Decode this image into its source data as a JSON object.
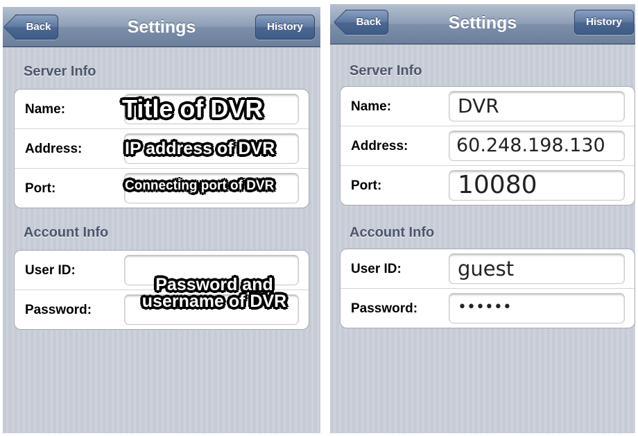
{
  "left": {
    "nav": {
      "back": "Back",
      "title": "Settings",
      "history": "History"
    },
    "server_section": "Server Info",
    "server_rows": [
      {
        "label": "Name:",
        "annotation": "Title of DVR"
      },
      {
        "label": "Address:",
        "annotation": "IP address of DVR"
      },
      {
        "label": "Port:",
        "annotation": "Connecting port of DVR"
      }
    ],
    "account_section": "Account Info",
    "account_rows": [
      {
        "label": "User ID:"
      },
      {
        "label": "Password:"
      }
    ],
    "account_annotation_line1": "Password and",
    "account_annotation_line2": "username of DVR"
  },
  "right": {
    "nav": {
      "back": "Back",
      "title": "Settings",
      "history": "History"
    },
    "server_section": "Server Info",
    "server_rows": [
      {
        "label": "Name:",
        "value": "DVR"
      },
      {
        "label": "Address:",
        "value": "60.248.198.130"
      },
      {
        "label": "Port:",
        "value": "10080"
      }
    ],
    "account_section": "Account Info",
    "account_rows": [
      {
        "label": "User ID:",
        "value": "guest"
      },
      {
        "label": "Password:",
        "value": "••••••"
      }
    ]
  }
}
